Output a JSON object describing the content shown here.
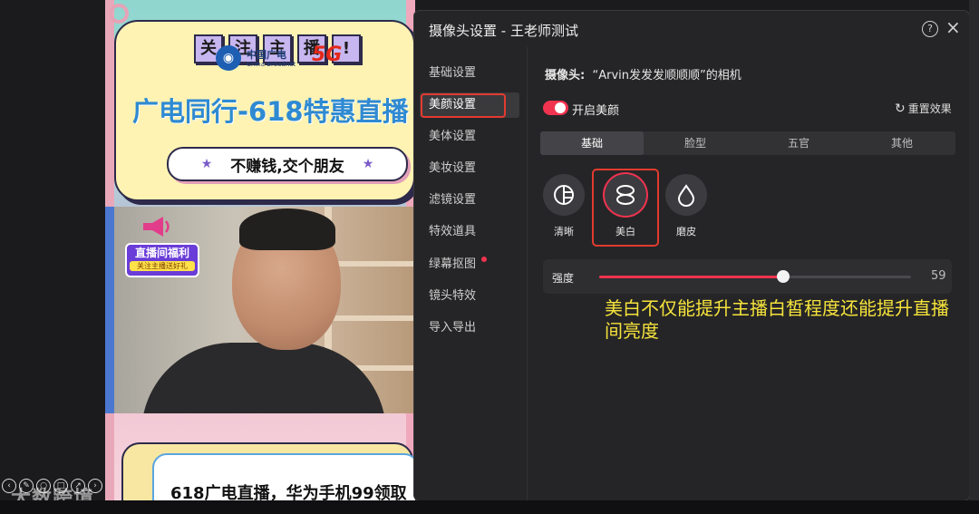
{
  "poster": {
    "chips": [
      "关",
      "注",
      "主",
      "播",
      "!"
    ],
    "broadnet_cn": "中国广电",
    "broadnet_en": "China Broadnet",
    "five_g": "5G",
    "headline": "广电同行-618特惠直播",
    "slogan": "不赚钱,交个朋友",
    "welfare_title": "直播间福利",
    "welfare_sub": "关注主播送好礼",
    "bottom_text": "618广电直播，华为手机99领取"
  },
  "watermark": "大数跨境",
  "dialog": {
    "title": "摄像头设置 - 王老师测试",
    "help_glyph": "?",
    "close_glyph": "×",
    "nav": [
      {
        "label": "基础设置"
      },
      {
        "label": "美颜设置",
        "active": true
      },
      {
        "label": "美体设置"
      },
      {
        "label": "美妆设置"
      },
      {
        "label": "滤镜设置"
      },
      {
        "label": "特效道具"
      },
      {
        "label": "绿幕抠图",
        "has_dot": true
      },
      {
        "label": "镜头特效"
      },
      {
        "label": "导入导出"
      }
    ],
    "camera_key": "摄像头:",
    "camera_value": "“Arvin发发发顺顺顺”的相机",
    "beauty_toggle_label": "开启美颜",
    "beauty_enabled": true,
    "reset_label": "重置效果",
    "tabs": [
      {
        "label": "基础",
        "active": true
      },
      {
        "label": "脸型"
      },
      {
        "label": "五官"
      },
      {
        "label": "其他"
      }
    ],
    "effects": [
      {
        "label": "清晰",
        "icon": "clarity-icon"
      },
      {
        "label": "美白",
        "icon": "whitening-icon",
        "selected": true
      },
      {
        "label": "磨皮",
        "icon": "smoothing-icon"
      }
    ],
    "intensity_label": "强度",
    "intensity_value": 59,
    "intensity_max": 100,
    "annotation": "美白不仅能提升主播白皙程度还能提升直播间亮度"
  },
  "colors": {
    "accent": "#f0334f",
    "highlight_box": "#e33a2f",
    "annotation": "#f6e33b",
    "dialog_bg": "#252527"
  }
}
